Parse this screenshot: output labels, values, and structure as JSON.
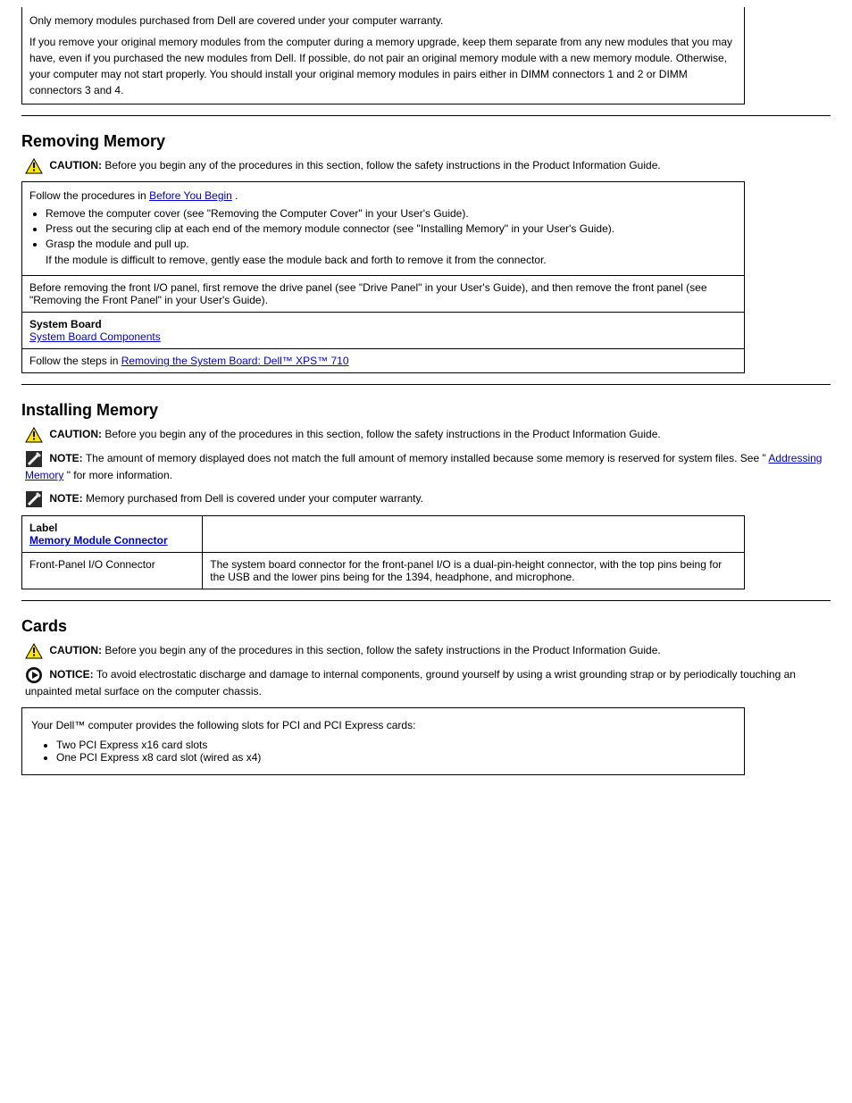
{
  "topbox": {
    "text1": "Only memory modules purchased from Dell are covered under your computer warranty.",
    "text2": "If you remove your original memory modules from the computer during a memory upgrade, keep them separate from any new modules that you may have, even if you purchased the new modules from Dell. If possible, do not pair an original memory module with a new memory module. Otherwise, your computer may not start properly. You should install your original memory modules in pairs either in DIMM connectors 1 and 2 or DIMM connectors 3 and 4."
  },
  "section_remove_mem": {
    "title": "Removing Memory",
    "caution_label": "CAUTION:",
    "caution_text": " Before you begin any of the procedures in this section, follow the safety instructions in the Product Information Guide."
  },
  "remove_steps_box": {
    "intro": "Follow the procedures in ",
    "intro_link": "Before You Begin",
    "intro_after": ".",
    "bullets": [
      "Remove the computer cover (see \"Removing the Computer Cover\" in your User's Guide).",
      "Press out the securing clip at each end of the memory module connector (see \"Installing Memory\" in your User's Guide).",
      "Grasp the module and pull up.",
      "If the module is difficult to remove, gently ease the module back and forth to remove it from the connector."
    ],
    "row2": "Before removing the front I/O panel, first remove the drive panel (see \"Drive Panel\" in your User's Guide), and then remove the front panel (see \"Removing the Front Panel\" in your User's Guide).",
    "row3_label": "System Board",
    "row3_link": "System Board Components",
    "row4_prefix": "Follow the steps in ",
    "row4_link": "Removing the System Board: Dell™ XPS™ 710"
  },
  "section_install_mem": {
    "title": "Installing Memory",
    "caution_label": "CAUTION:",
    "caution_text": " Before you begin any of the procedures in this section, follow the safety instructions in the Product Information Guide.",
    "note1_label": "NOTE:",
    "note1_text": " The amount of memory displayed does not match the full amount of memory installed because some memory is reserved for system files. See \"",
    "note1_link": "Addressing Memory",
    "note1_after": "\" for more information.",
    "note2_label": "NOTE:",
    "note2_text": " Memory purchased from Dell is covered under your computer warranty."
  },
  "mem_table": {
    "head_label": "Label",
    "head_link": "Memory Module Connector",
    "row1_c1": "Front-Panel I/O Connector",
    "row1_c2": "The system board connector for the front-panel I/O is a dual-pin-height connector, with the top pins being for the USB and the lower pins being for the 1394, headphone, and microphone."
  },
  "section_cards": {
    "title": "Cards",
    "caution_label": "CAUTION:",
    "caution_text": " Before you begin any of the procedures in this section, follow the safety instructions in the Product Information Guide.",
    "notice_label": "NOTICE:",
    "notice_text": " To avoid electrostatic discharge and damage to internal components, ground yourself by using a wrist grounding strap or by periodically touching an unpainted metal surface on the computer chassis."
  },
  "cards_box": {
    "line1_prefix": "Your Dell™ computer provides the following slots for PCI and PCI Express cards:",
    "bullets": [
      "Two PCI Express x16 card slots",
      "One PCI Express x8 card slot (wired as x4)"
    ]
  }
}
